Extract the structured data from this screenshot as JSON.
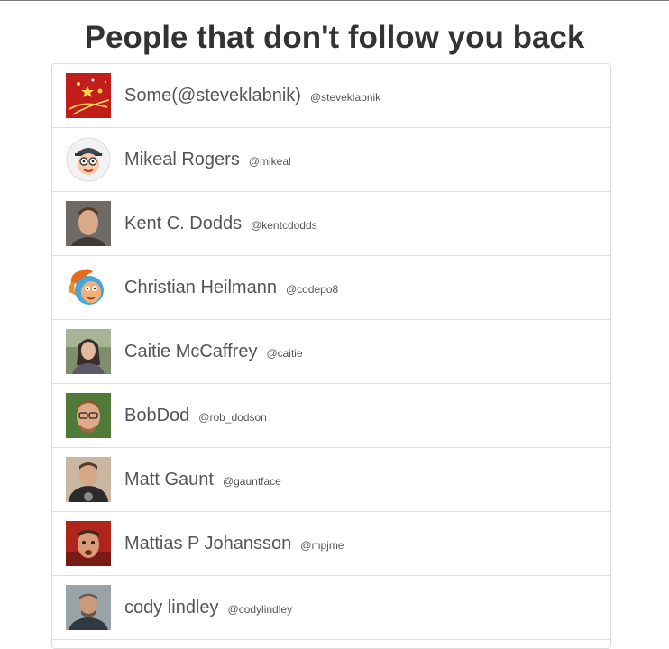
{
  "page": {
    "title": "People that don't follow you back"
  },
  "users": [
    {
      "name": "Some(@steveklabnik)",
      "handle": "@steveklabnik",
      "avatar": "avatar-sparkles-red"
    },
    {
      "name": "Mikeal Rogers",
      "handle": "@mikeal",
      "avatar": "avatar-cartoon-face"
    },
    {
      "name": "Kent C. Dodds",
      "handle": "@kentcdodds",
      "avatar": "avatar-photo"
    },
    {
      "name": "Christian Heilmann",
      "handle": "@codepo8",
      "avatar": "avatar-cartoon-orange"
    },
    {
      "name": "Caitie McCaffrey",
      "handle": "@caitie",
      "avatar": "avatar-photo"
    },
    {
      "name": "BobDod",
      "handle": "@rob_dodson",
      "avatar": "avatar-photo"
    },
    {
      "name": "Matt Gaunt",
      "handle": "@gauntface",
      "avatar": "avatar-photo"
    },
    {
      "name": "Mattias P Johansson",
      "handle": "@mpjme",
      "avatar": "avatar-photo"
    },
    {
      "name": "cody lindley",
      "handle": "@codylindley",
      "avatar": "avatar-photo"
    }
  ]
}
